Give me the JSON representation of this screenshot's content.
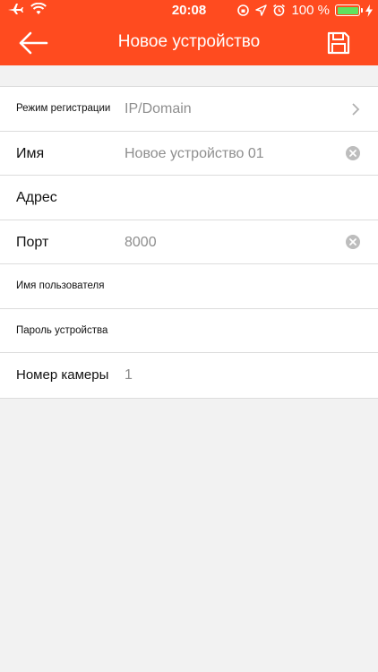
{
  "status_bar": {
    "time": "20:08",
    "battery": "100 %"
  },
  "header": {
    "title": "Новое устройство"
  },
  "form": {
    "rows": [
      {
        "label": "Режим регистрации",
        "value": "IP/Domain"
      },
      {
        "label": "Имя",
        "value": "Новое устройство 01"
      },
      {
        "label": "Адрес",
        "value": ""
      },
      {
        "label": "Порт",
        "value": "8000"
      },
      {
        "label": "Имя пользователя",
        "value": ""
      },
      {
        "label": "Пароль устройства",
        "value": ""
      },
      {
        "label": "Номер камеры",
        "value": "1"
      }
    ]
  },
  "colors": {
    "accent": "#ff4b1f",
    "battery": "#5ee25e"
  },
  "icons": {
    "back": "arrow-left-icon",
    "save": "floppy-disk-icon",
    "clear": "clear-circle-icon",
    "chevron": "chevron-right-icon"
  }
}
